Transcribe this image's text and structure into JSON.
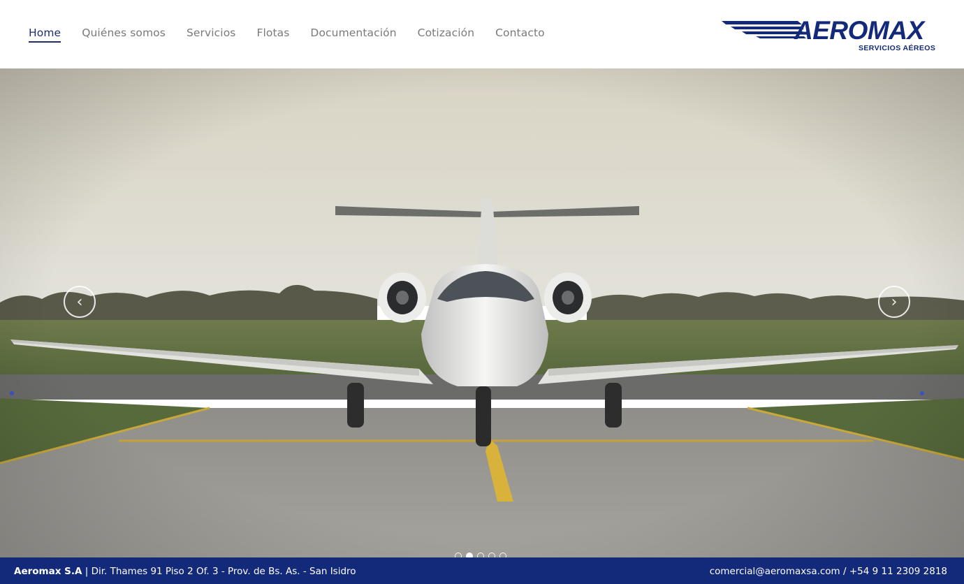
{
  "nav": {
    "items": [
      {
        "label": "Home",
        "active": true
      },
      {
        "label": "Quiénes somos"
      },
      {
        "label": "Servicios"
      },
      {
        "label": "Flotas"
      },
      {
        "label": "Documentación"
      },
      {
        "label": "Cotización"
      },
      {
        "label": "Contacto"
      }
    ]
  },
  "logo": {
    "name": "AEROMAX",
    "tagline": "SERVICIOS AÉREOS",
    "color": "#13297a"
  },
  "hero": {
    "prev_icon": "chevron-left-icon",
    "next_icon": "chevron-right-icon",
    "prev_glyph": "‹",
    "next_glyph": "›",
    "slide_count": 5,
    "active_slide": 2
  },
  "footer": {
    "company": "Aeromax S.A",
    "separator": " | ",
    "address": "Dir. Thames 91 Piso 2 Of. 3 - Prov. de Bs. As. - San Isidro",
    "email": "comercial@aeromaxsa.com",
    "contact_separator": " / ",
    "phone": "+54 9 11 2309 2818",
    "background": "#13297a"
  }
}
